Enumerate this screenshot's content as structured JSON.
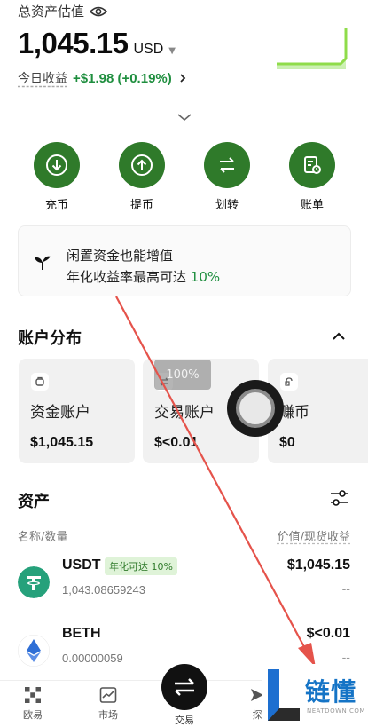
{
  "header": {
    "total_label": "总资产估值",
    "amount": "1,045.15",
    "currency": "USD",
    "today_label": "今日收益",
    "today_value": "+$1.98 (+0.19%)"
  },
  "actions": [
    {
      "label": "充币",
      "icon": "deposit-icon"
    },
    {
      "label": "提币",
      "icon": "withdraw-icon"
    },
    {
      "label": "划转",
      "icon": "transfer-icon"
    },
    {
      "label": "账单",
      "icon": "bill-icon"
    }
  ],
  "promo": {
    "line1": "闲置资金也能增值",
    "line2_prefix": "年化收益率最高可达",
    "line2_rate": "10%"
  },
  "account_section": {
    "title": "账户分布",
    "cards": [
      {
        "name": "资金账户",
        "value": "$1,045.15",
        "icon": "wallet-icon"
      },
      {
        "name": "交易账户",
        "value": "$<0.01",
        "icon": "trade-account-icon"
      },
      {
        "name": "赚币",
        "value": "$0",
        "icon": "earn-icon"
      }
    ],
    "overlay_badge": "100%"
  },
  "assets_section": {
    "title": "资产",
    "col_left": "名称/数量",
    "col_right": "价值/现货收益",
    "rows": [
      {
        "symbol": "USDT",
        "tag": "年化可达 10%",
        "qty": "1,043.08659243",
        "value": "$1,045.15",
        "pnl": "--",
        "color": "#26a17b"
      },
      {
        "symbol": "BETH",
        "tag": "",
        "qty": "0.00000059",
        "value": "$<0.01",
        "pnl": "--",
        "color": "#2f6fd6"
      }
    ]
  },
  "bottom_nav": {
    "items": [
      "欧易",
      "市场",
      "交易",
      "探"
    ]
  },
  "watermark": {
    "text": "链懂",
    "sub": "NEATDOWN.COM"
  },
  "colors": {
    "accent_green": "#2f7a2a",
    "profit_green": "#1e8e3e",
    "arrow_red": "#e5534b"
  }
}
